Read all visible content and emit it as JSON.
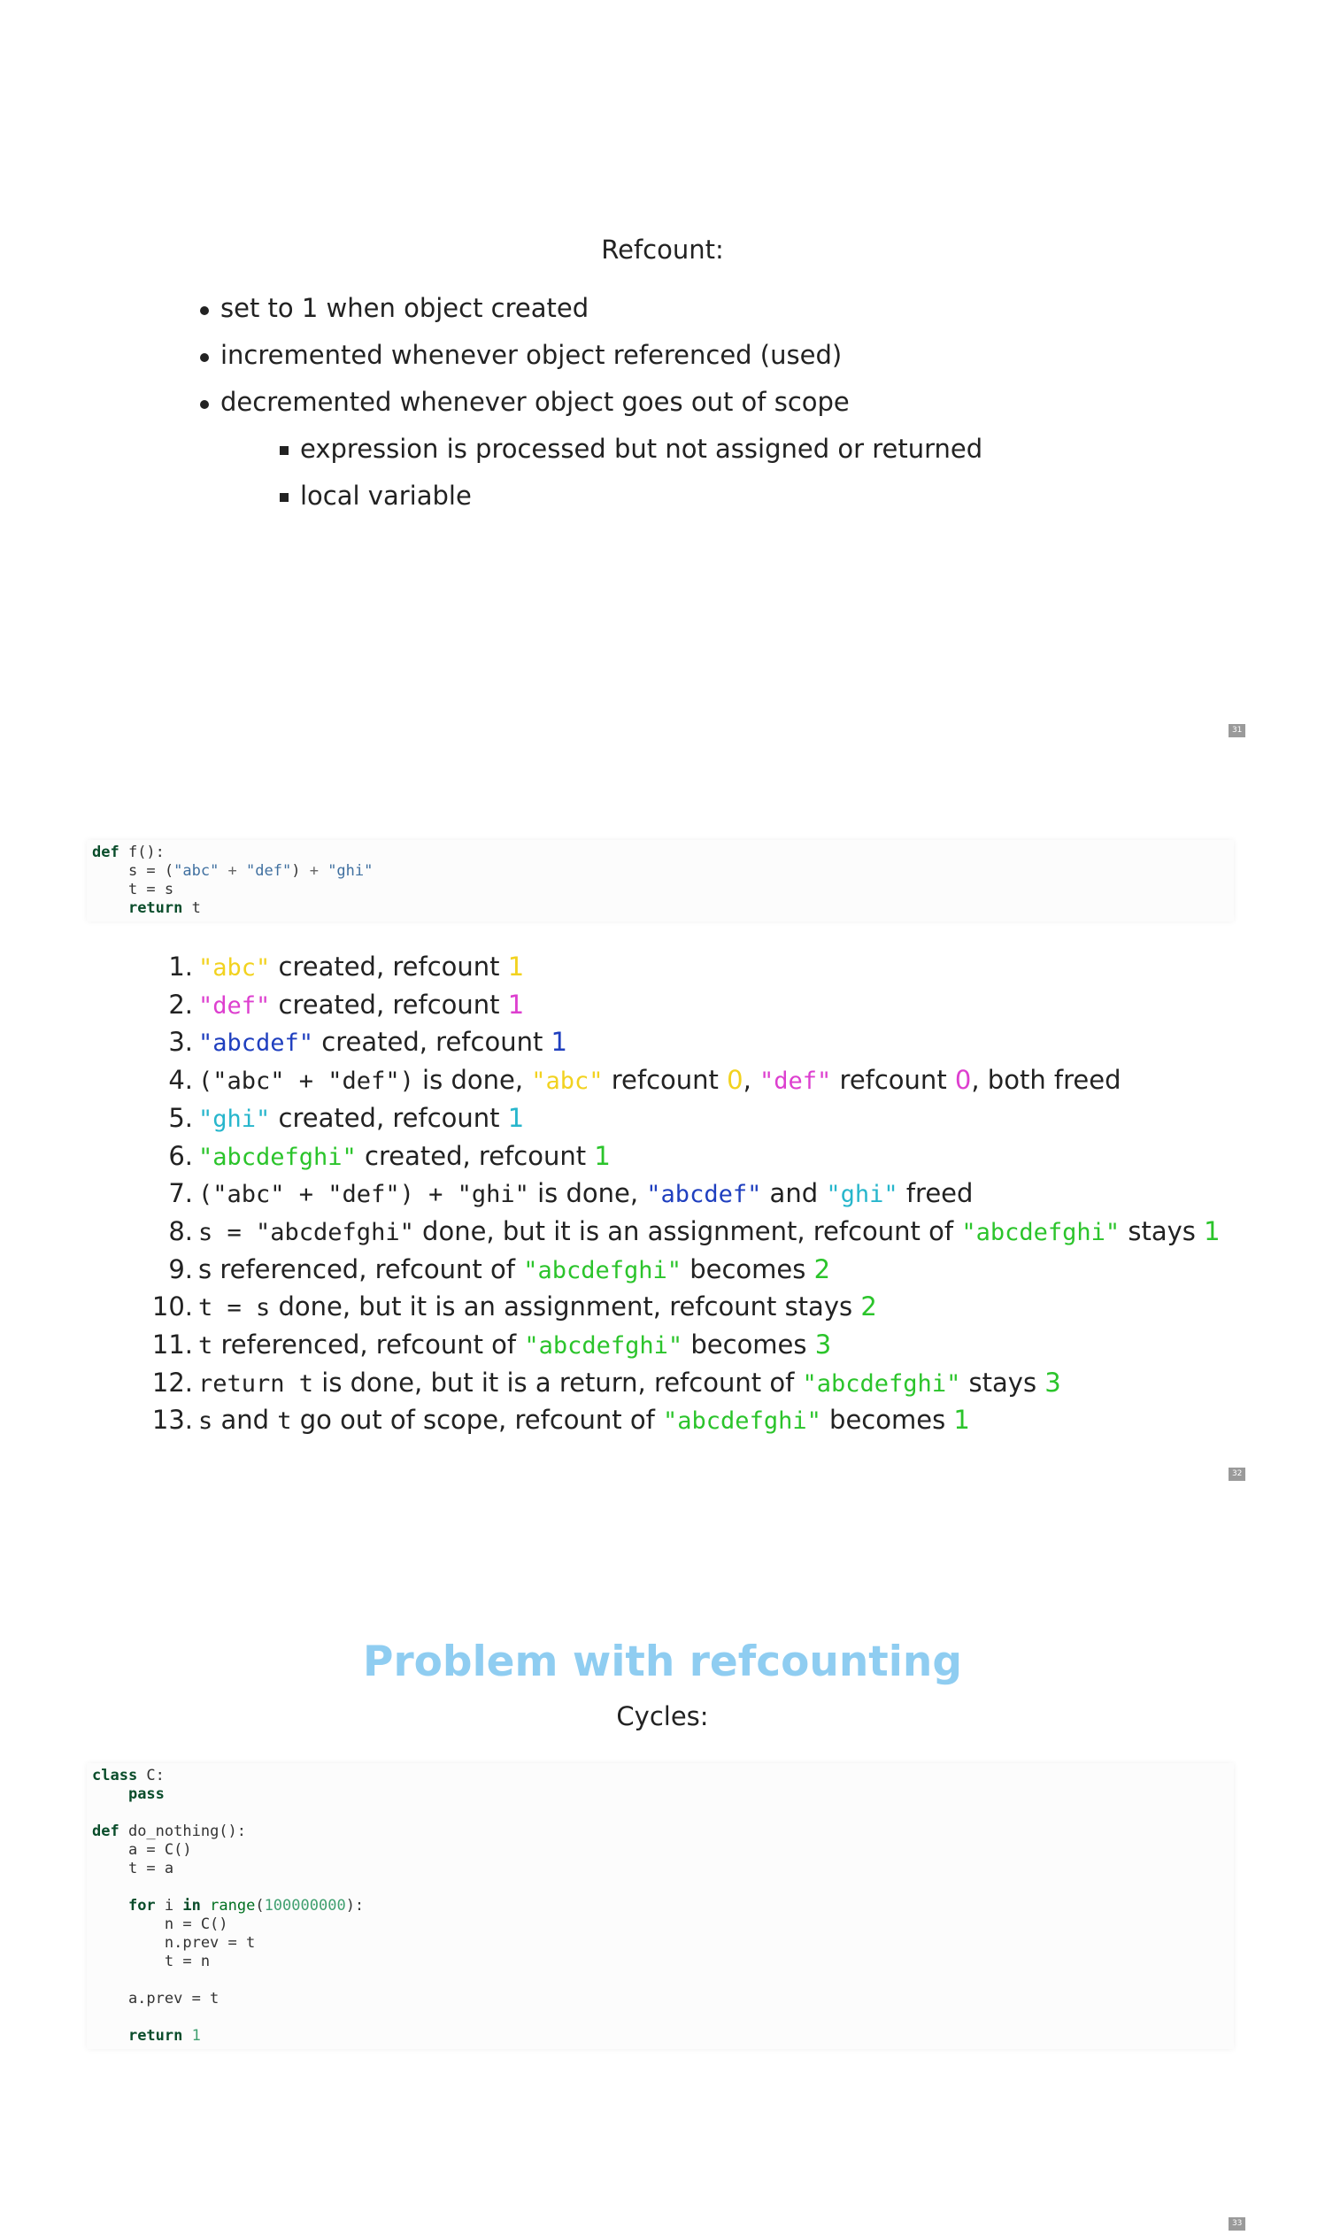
{
  "slide31": {
    "title": "Refcount:",
    "bullets": [
      "set to 1 when object created",
      "incremented whenever object referenced (used)",
      "decremented whenever object goes out of scope"
    ],
    "sub_bullets": [
      "expression is processed but not assigned or returned",
      "local variable"
    ],
    "page_number": "31"
  },
  "slide32": {
    "code": {
      "l1_kw": "def",
      "l1_rest": " f():",
      "l2_pre": "    s = (",
      "l2_s1": "\"abc\"",
      "l2_op1": " + ",
      "l2_s2": "\"def\"",
      "l2_mid": ") ",
      "l2_op2": "+ ",
      "l2_s3": "\"ghi\"",
      "l3": "    t = s",
      "l4_pre": "    ",
      "l4_kw": "return",
      "l4_rest": " t"
    },
    "steps": {
      "n1": "1.",
      "n2": "2.",
      "n3": "3.",
      "n4": "4.",
      "n5": "5.",
      "n6": "6.",
      "n7": "7.",
      "n8": "8.",
      "n9": "9.",
      "n10": "10.",
      "n11": "11.",
      "n12": "12.",
      "n13": "13.",
      "s_abc": "\"abc\"",
      "s_def": "\"def\"",
      "s_abcdef": "\"abcdef\"",
      "s_ghi": "\"ghi\"",
      "s_abcdefghi": "\"abcdefghi\"",
      "created_refcount": " created, refcount ",
      "one": "1",
      "zero": "0",
      "two": "2",
      "three": "3",
      "expr1": "(\"abc\" + \"def\")",
      "is_done_comma": " is done, ",
      "refcount_sp": " refcount ",
      "comma_sp": ", ",
      "both_freed": ", both freed",
      "expr2": "(\"abc\" + \"def\") + \"ghi\"",
      "and_sp": " and ",
      "freed": " freed",
      "assign_s": "s = \"abcdefghi\"",
      "done_assign_refcount_of": " done, but it is an assignment, refcount of ",
      "stays_sp": " stays ",
      "s_referenced": "s referenced, refcount of ",
      "becomes_sp": " becomes ",
      "assign_t": "t = s",
      "done_assign_stays": " done, but it is an assignment, refcount stays ",
      "t_mono": "t",
      "referenced_refcount_of": " referenced, refcount of ",
      "return_t": "return t",
      "is_done_return": " is done, but it is a return, refcount of ",
      "s_mono": "s",
      "and_word": " and ",
      "go_out": " go out of scope, refcount of "
    },
    "page_number": "32"
  },
  "slide33": {
    "heading": "Problem with refcounting",
    "subtitle": "Cycles:",
    "code": {
      "class_kw": "class",
      "class_rest": " C:",
      "pass_kw": "pass",
      "def_kw": "def",
      "def_rest": " do_nothing():",
      "a_eq": "    a = C()",
      "t_eq_a": "    t = a",
      "for_kw": "for",
      "i_sp": " i ",
      "in_kw": "in",
      "range_bi": "range",
      "lparen": "(",
      "big_num": "100000000",
      "rparen_colon": "):",
      "n_eq": "        n = C()",
      "nprev": "        n.prev = t",
      "t_eq_n": "        t = n",
      "aprev": "    a.prev = t",
      "return_kw": "return",
      "ret_num": "1"
    },
    "page_number": "33"
  },
  "colors": {
    "abc": "#f2d21f",
    "def": "#dd3fcf",
    "abcdef": "#1f3fbf",
    "ghi": "#27b6cc",
    "abcdefghi": "#2bc42b",
    "heading": "#8fcdf1",
    "keyword": "#0a4d2b",
    "string": "#4070a0",
    "number": "#40a070"
  }
}
